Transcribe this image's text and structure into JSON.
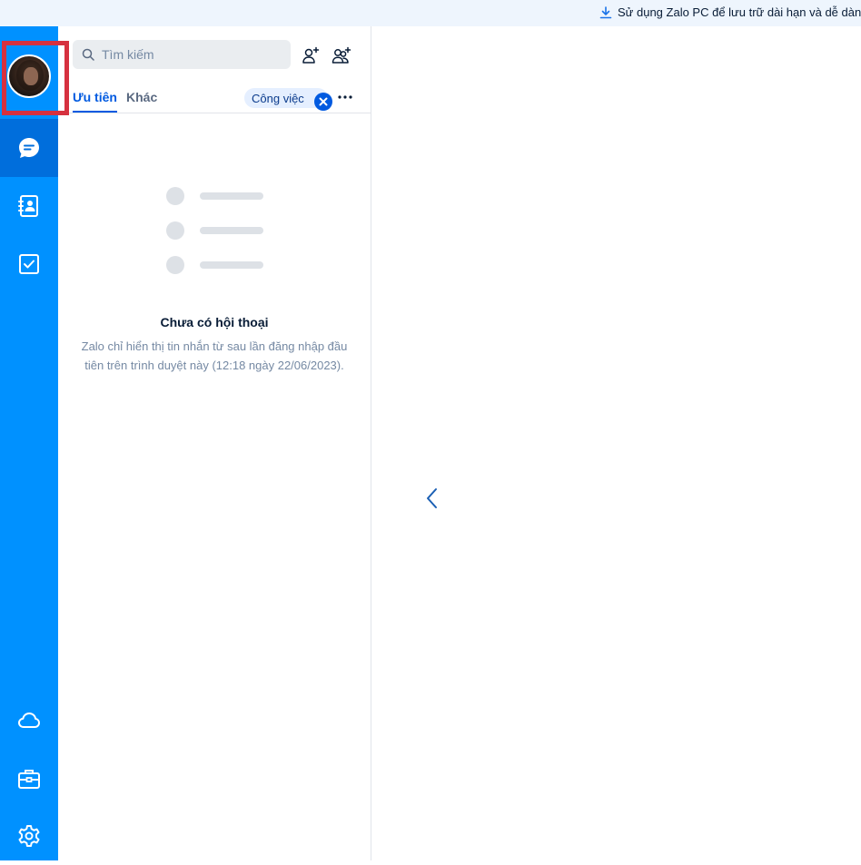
{
  "banner": {
    "text": "Sử dụng Zalo PC để lưu trữ dài hạn và dễ dàng",
    "icon": "download-icon"
  },
  "nav": {
    "avatar": "user-avatar",
    "items": [
      {
        "name": "messages",
        "icon": "chat-icon",
        "active": true
      },
      {
        "name": "contacts",
        "icon": "contact-book-icon",
        "active": false
      },
      {
        "name": "todo",
        "icon": "checkbox-icon",
        "active": false
      },
      {
        "name": "cloud",
        "icon": "cloud-icon",
        "active": false
      },
      {
        "name": "toolbox",
        "icon": "briefcase-icon",
        "active": false
      },
      {
        "name": "settings",
        "icon": "gear-icon",
        "active": false
      }
    ]
  },
  "search": {
    "placeholder": "Tìm kiếm"
  },
  "tabs": {
    "priority": "Ưu tiên",
    "other": "Khác",
    "label_chip": "Công việc"
  },
  "empty": {
    "title": "Chưa có hội thoại",
    "description": "Zalo chỉ hiển thị tin nhắn từ sau lần đăng nhập đầu tiên trên trình duyệt này (12:18 ngày 22/06/2023)."
  },
  "colors": {
    "nav_bg": "#0091ff",
    "nav_active": "#006edc",
    "accent": "#005ae0",
    "highlight_box": "#d6313f"
  }
}
